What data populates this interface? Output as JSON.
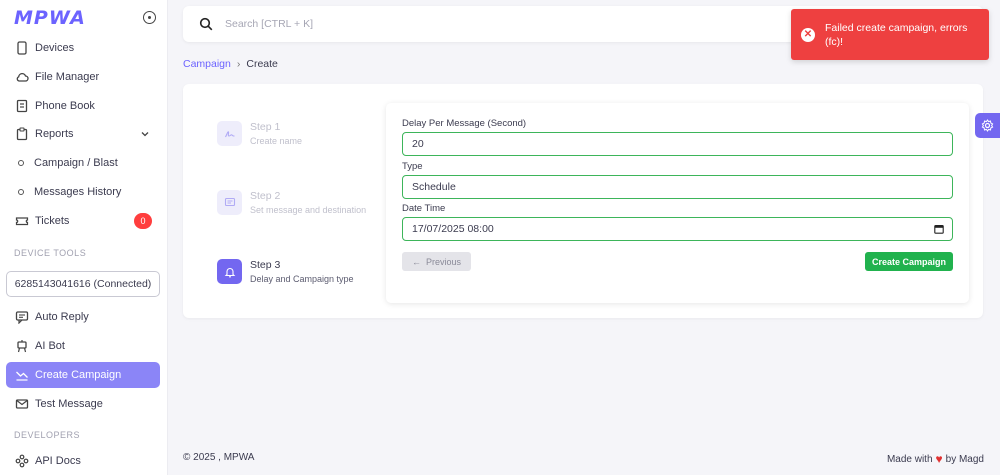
{
  "app": {
    "logo": "MPWA"
  },
  "sidebar": {
    "items": [
      {
        "label": "Devices",
        "icon": "phone-icon"
      },
      {
        "label": "File Manager",
        "icon": "cloud-icon"
      },
      {
        "label": "Phone Book",
        "icon": "book-icon"
      },
      {
        "label": "Reports",
        "icon": "clipboard-icon"
      },
      {
        "label": "Campaign / Blast",
        "icon": "circle-icon"
      },
      {
        "label": "Messages History",
        "icon": "circle-icon"
      },
      {
        "label": "Tickets",
        "icon": "ticket-icon",
        "badge": "0"
      }
    ],
    "device_tools_label": "DEVICE TOOLS",
    "device_selected": "6285143041616 (Connected)",
    "tools": [
      {
        "label": "Auto Reply",
        "icon": "message-icon"
      },
      {
        "label": "AI Bot",
        "icon": "robot-icon"
      },
      {
        "label": "Create Campaign",
        "icon": "campaign-icon"
      },
      {
        "label": "Test Message",
        "icon": "mail-icon"
      }
    ],
    "developers_label": "DEVELOPERS",
    "dev_items": [
      {
        "label": "API Docs",
        "icon": "api-icon"
      }
    ]
  },
  "search": {
    "placeholder": "Search [CTRL + K]"
  },
  "toast": {
    "message": "Failed create campaign, errors (fc)!",
    "color": "#ee4040"
  },
  "breadcrumb": {
    "parent": "Campaign",
    "current": "Create"
  },
  "steps": [
    {
      "title": "Step 1",
      "desc": "Create name"
    },
    {
      "title": "Step 2",
      "desc": "Set message and destination"
    },
    {
      "title": "Step 3",
      "desc": "Delay and Campaign type"
    }
  ],
  "form": {
    "delay_label": "Delay Per Message (Second)",
    "delay_value": "20",
    "type_label": "Type",
    "type_value": "Schedule",
    "datetime_label": "Date Time",
    "datetime_value": "17/07/2025 08:00",
    "prev_label": "Previous",
    "submit_label": "Create Campaign"
  },
  "footer": {
    "left": "© 2025 , MPWA",
    "made_with": "Made with",
    "by": "by Magd"
  },
  "colors": {
    "accent": "#7367f0",
    "success": "#21b24e",
    "danger": "#ee4040"
  }
}
